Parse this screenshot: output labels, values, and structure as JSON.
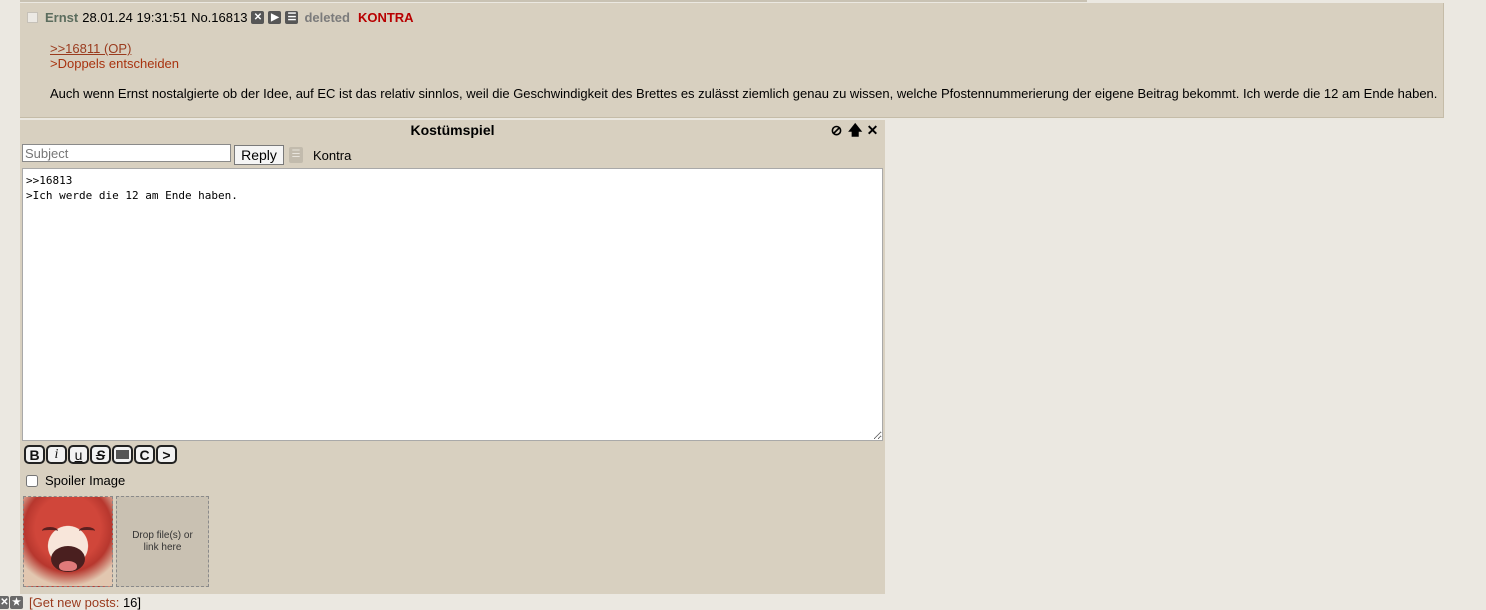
{
  "post": {
    "name": "Ernst",
    "date": "28.01.24 19:31:51",
    "number": "No.16813",
    "icons": [
      "close-icon",
      "play-icon",
      "menu-icon"
    ],
    "deleted": "deleted",
    "flag": "KONTRA",
    "quote_link": ">>16811 (OP)",
    "greentext": ">Doppels entscheiden",
    "body": "Auch wenn Ernst nostalgierte ob der Idee, auf EC ist das relativ sinnlos, weil die Geschwindigkeit des Brettes es zulässt ziemlich genau zu wissen, welche Pfostennummerierung der eigene Beitrag bekommt. Ich werde die 12 am Ende haben."
  },
  "quick_reply": {
    "title": "Kostümspiel",
    "controls": [
      "⊘",
      "🡅",
      "✕"
    ],
    "subject_placeholder": "Subject",
    "reply_label": "Reply",
    "flag_label": "Kontra",
    "message": ">>16813\n>Ich werde die 12 am Ende haben.",
    "format_buttons": [
      "B",
      "i",
      "u",
      "S",
      "",
      "C",
      ">"
    ],
    "spoiler_label": "Spoiler Image",
    "drop_text": "Drop file(s) or link here"
  },
  "bottom_bar": {
    "link_text": "[Get new posts:",
    "count": "16]"
  },
  "colors": {
    "post_bg": "#d8d0c0",
    "page_bg": "#ebe8e1",
    "name": "#5c6d5e",
    "flag": "#b80000",
    "quote": "#9a3b1e"
  }
}
